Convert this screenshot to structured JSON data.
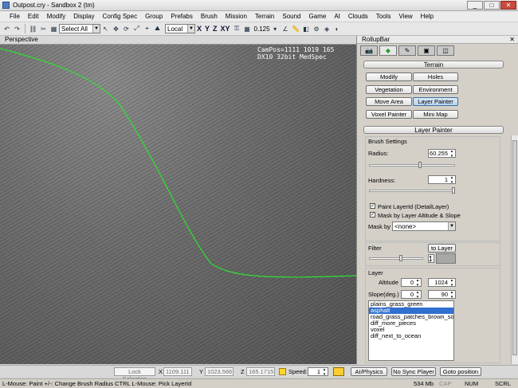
{
  "window": {
    "title": "Outpost.cry - Sandbox 2 (tm)",
    "minimize": "_",
    "maximize": "□",
    "close": "✕"
  },
  "menu": [
    "File",
    "Edit",
    "Modify",
    "Display",
    "Config Spec",
    "Group",
    "Prefabs",
    "Brush",
    "Mission",
    "Terrain",
    "Sound",
    "Game",
    "AI",
    "Clouds",
    "Tools",
    "View",
    "Help"
  ],
  "toolbar": {
    "selection": "Select All",
    "coord_system": "Local",
    "axes": [
      "X",
      "Y",
      "Z",
      "XY"
    ],
    "grid_value": "0.125"
  },
  "viewport": {
    "label": "Perspective",
    "campos": "CamPos=1111 1019 165\nDX10 32bit MedSpec"
  },
  "rollup": {
    "title": "RollupBar",
    "close": "✕",
    "terrain_header": "Terrain",
    "buttons": {
      "modify": "Modify",
      "holes": "Holes",
      "vegetation": "Vegetation",
      "environment": "Environment",
      "move_area": "Move Area",
      "layer_painter": "Layer Painter",
      "voxel_painter": "Voxel Painter",
      "mini_map": "Mini Map"
    },
    "layer_painter_header": "Layer Painter",
    "brush_settings": "Brush Settings",
    "radius_label": "Radius:",
    "radius_value": "60.255",
    "radius_slider": 0.6,
    "hardness_label": "Hardness:",
    "hardness_value": "1",
    "hardness_slider": 1.0,
    "paint_layerid": "Paint LayerId (DetailLayer)",
    "mask_by_altitude": "Mask by Layer Altitude & Slope",
    "mask_by_label": "Mask by",
    "mask_by_value": "<none>",
    "filter_label": "Filter",
    "to_layer": "to Layer",
    "filter_value": "1",
    "layer_label": "Layer",
    "altitude_label": "Altitude",
    "altitude_min": "0",
    "altitude_max": "1024",
    "slope_label": "Slope(deg.)",
    "slope_min": "0",
    "slope_max": "90",
    "layers": [
      "plains_grass_green",
      "asphalt",
      "road_grass_patches_brown_soil",
      "diff_more_pieces",
      "voxel",
      "diff_next_to_ocean"
    ],
    "selected_layer_index": 1
  },
  "statusbar": {
    "lock_selection": "Lock Selection",
    "x_label": "X",
    "x_value": "1109.111",
    "y_label": "Y",
    "y_value": "1023.566",
    "z_label": "Z",
    "z_value": "165.1715",
    "speed_label": "Speed:",
    "speed_value": "1",
    "ai_physics": "AI/Physics",
    "no_sync_player": "No Sync Player",
    "goto_position": "Goto position"
  },
  "bottom": {
    "hint": "L-Mouse: Paint  +/-: Change Brush Radius   CTRL L-Mouse: Pick LayerId",
    "memory": "534 Mb",
    "cap": "CAP",
    "num": "NUM",
    "scrl": "SCRL"
  }
}
